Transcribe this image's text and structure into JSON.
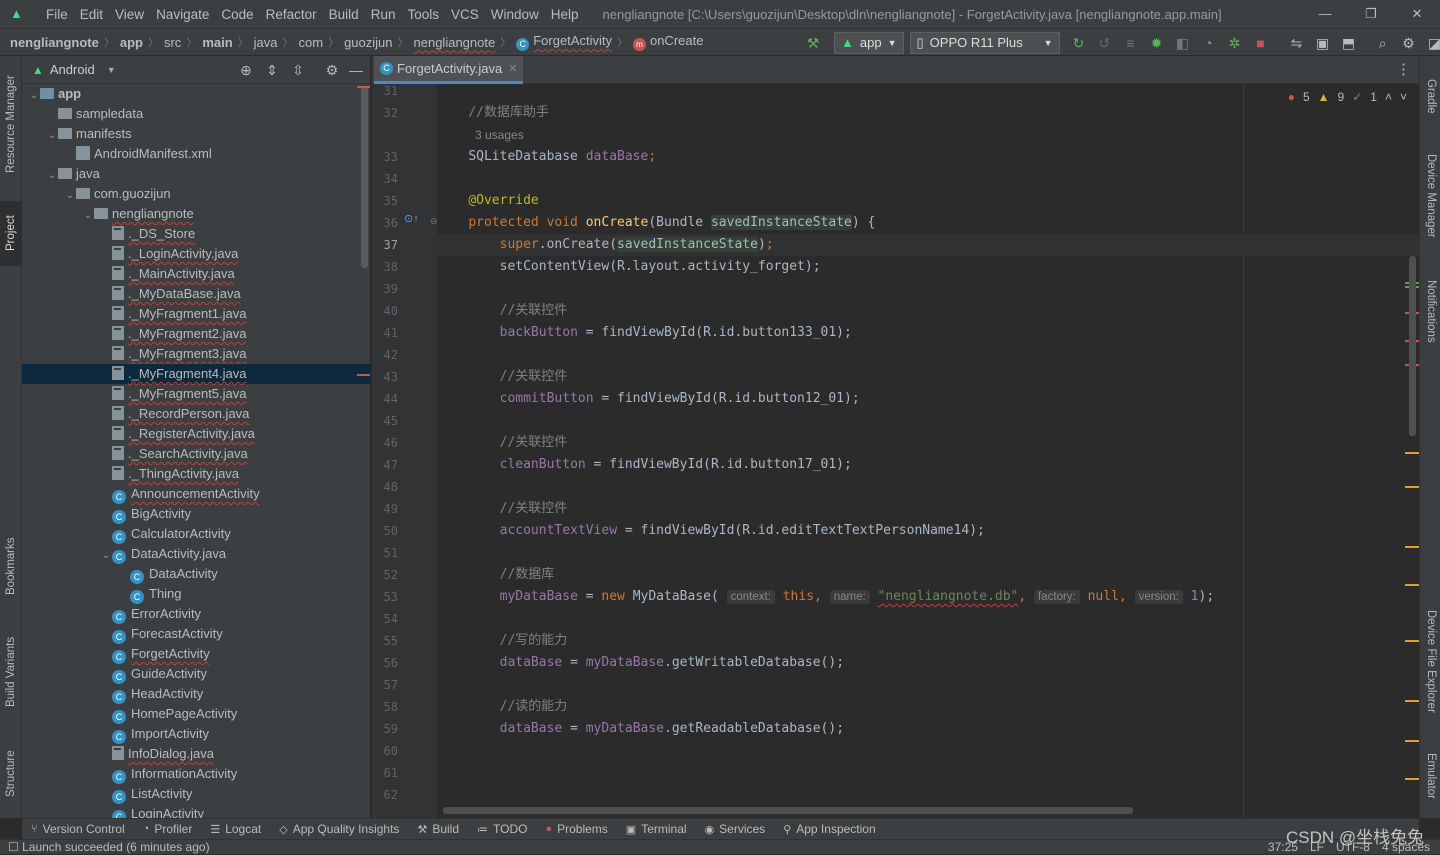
{
  "menubar": {
    "items": [
      "File",
      "Edit",
      "View",
      "Navigate",
      "Code",
      "Refactor",
      "Build",
      "Run",
      "Tools",
      "VCS",
      "Window",
      "Help"
    ],
    "window_title": "nengliangnote [C:\\Users\\guozijun\\Desktop\\dln\\nengliangnote] - ForgetActivity.java [nengliangnote.app.main]"
  },
  "breadcrumb": {
    "items": [
      "nengliangnote",
      "app",
      "src",
      "main",
      "java",
      "com",
      "guozijun",
      "nengliangnote",
      "ForgetActivity",
      "onCreate"
    ]
  },
  "run_toolbar": {
    "config": "app",
    "device": "OPPO R11 Plus"
  },
  "project_panel": {
    "view_mode": "Android",
    "tree": [
      {
        "label": "app",
        "depth": 0,
        "kind": "module",
        "expanded": true
      },
      {
        "label": "sampledata",
        "depth": 1,
        "kind": "folder"
      },
      {
        "label": "manifests",
        "depth": 1,
        "kind": "folder",
        "expanded": true
      },
      {
        "label": "AndroidManifest.xml",
        "depth": 2,
        "kind": "manifest"
      },
      {
        "label": "java",
        "depth": 1,
        "kind": "folder",
        "expanded": true
      },
      {
        "label": "com.guozijun",
        "depth": 2,
        "kind": "package",
        "expanded": true
      },
      {
        "label": "nengliangnote",
        "depth": 3,
        "kind": "package",
        "expanded": true
      },
      {
        "label": "._DS_Store",
        "depth": 4,
        "kind": "file"
      },
      {
        "label": "._LoginActivity.java",
        "depth": 4,
        "kind": "file"
      },
      {
        "label": "._MainActivity.java",
        "depth": 4,
        "kind": "file"
      },
      {
        "label": "._MyDataBase.java",
        "depth": 4,
        "kind": "file"
      },
      {
        "label": "._MyFragment1.java",
        "depth": 4,
        "kind": "file"
      },
      {
        "label": "._MyFragment2.java",
        "depth": 4,
        "kind": "file"
      },
      {
        "label": "._MyFragment3.java",
        "depth": 4,
        "kind": "file"
      },
      {
        "label": "._MyFragment4.java",
        "depth": 4,
        "kind": "file",
        "selected": true
      },
      {
        "label": "._MyFragment5.java",
        "depth": 4,
        "kind": "file"
      },
      {
        "label": "._RecordPerson.java",
        "depth": 4,
        "kind": "file"
      },
      {
        "label": "._RegisterActivity.java",
        "depth": 4,
        "kind": "file"
      },
      {
        "label": "._SearchActivity.java",
        "depth": 4,
        "kind": "file"
      },
      {
        "label": "._ThingActivity.java",
        "depth": 4,
        "kind": "file"
      },
      {
        "label": "AnnouncementActivity",
        "depth": 4,
        "kind": "class"
      },
      {
        "label": "BigActivity",
        "depth": 4,
        "kind": "class"
      },
      {
        "label": "CalculatorActivity",
        "depth": 4,
        "kind": "class"
      },
      {
        "label": "DataActivity.java",
        "depth": 4,
        "kind": "class",
        "expanded": true
      },
      {
        "label": "DataActivity",
        "depth": 5,
        "kind": "class"
      },
      {
        "label": "Thing",
        "depth": 5,
        "kind": "class"
      },
      {
        "label": "ErrorActivity",
        "depth": 4,
        "kind": "class"
      },
      {
        "label": "ForecastActivity",
        "depth": 4,
        "kind": "class"
      },
      {
        "label": "ForgetActivity",
        "depth": 4,
        "kind": "class"
      },
      {
        "label": "GuideActivity",
        "depth": 4,
        "kind": "class"
      },
      {
        "label": "HeadActivity",
        "depth": 4,
        "kind": "class"
      },
      {
        "label": "HomePageActivity",
        "depth": 4,
        "kind": "class"
      },
      {
        "label": "ImportActivity",
        "depth": 4,
        "kind": "class"
      },
      {
        "label": "InfoDialog.java",
        "depth": 4,
        "kind": "file"
      },
      {
        "label": "InformationActivity",
        "depth": 4,
        "kind": "class"
      },
      {
        "label": "ListActivity",
        "depth": 4,
        "kind": "class"
      },
      {
        "label": "LoginActivity",
        "depth": 4,
        "kind": "class"
      }
    ]
  },
  "left_tool_tabs": [
    "Resource Manager",
    "Project",
    "Bookmarks",
    "Build Variants",
    "Structure"
  ],
  "right_tool_tabs": [
    "Gradle",
    "Device Manager",
    "Notifications",
    "Device File Explorer",
    "Emulator"
  ],
  "editor": {
    "tab_label": "ForgetActivity.java",
    "inspections": {
      "errors": "5",
      "warnings": "9",
      "weak_warnings": "1"
    },
    "usages_text": "3 usages",
    "line_numbers": [
      "31",
      "32",
      "",
      "33",
      "34",
      "35",
      "36",
      "37",
      "38",
      "39",
      "40",
      "41",
      "42",
      "43",
      "44",
      "45",
      "46",
      "47",
      "48",
      "49",
      "50",
      "51",
      "52",
      "53",
      "54",
      "55",
      "56",
      "57",
      "58",
      "59",
      "60",
      "61",
      "62"
    ],
    "current_line": "37",
    "code": {
      "c1": "//数据库助手",
      "l33_type": "SQLiteDatabase",
      "l33_field": "dataBase",
      "l35": "@Override",
      "l36_kw": "protected void",
      "l36_meth": "onCreate",
      "l36_type": "Bundle",
      "l36_param": "savedInstanceState",
      "l37_super": "super",
      "l37_call": ".onCreate(",
      "l37_arg": "savedInstanceState",
      "l38": "setContentView(R.layout.activity_forget);",
      "c_link": "//关联控件",
      "l41_field": "backButton",
      "l41_rest": " = findViewById(R.id.button133_01);",
      "l44_field": "commitButton",
      "l44_rest": " = findViewById(R.id.button12_01);",
      "l47_field": "cleanButton",
      "l47_rest": " = findViewById(R.id.button17_01);",
      "l50_field": "accountTextView",
      "l50_rest": " = findViewById(R.id.editTextTextPersonName14);",
      "c_db": "//数据库",
      "l53_field": "myDataBase",
      "l53_a": " = ",
      "l53_new": "new",
      "l53_cls": " MyDataBase(",
      "hint_context": "context:",
      "l53_this": "this",
      "hint_name": "name:",
      "l53_str": "\"nengliangnote.db\"",
      "hint_factory": "factory:",
      "l53_null": "null",
      "hint_version": "version:",
      "l53_num": "1",
      "l53_end": ");",
      "c_write": "//写的能力",
      "l56_field": "dataBase",
      "l56_mid": " = ",
      "l56_field2": "myDataBase",
      "l56_rest": ".getWritableDatabase();",
      "c_read": "//读的能力",
      "l59_field": "dataBase",
      "l59_mid": " = ",
      "l59_field2": "myDataBase",
      "l59_rest": ".getReadableDatabase();"
    }
  },
  "bottom_tools": [
    "Version Control",
    "Profiler",
    "Logcat",
    "App Quality Insights",
    "Build",
    "TODO",
    "Problems",
    "Terminal",
    "Services",
    "App Inspection"
  ],
  "statusbar": {
    "message": "Launch succeeded (6 minutes ago)",
    "position": "37:25",
    "line_sep": "LF",
    "encoding": "UTF-8",
    "indent": "4 spaces"
  },
  "watermark": "CSDN @坐栈兔兔",
  "colors": {
    "accent": "#4a88c7",
    "selection": "#0d293e",
    "android_green": "#3ddc84"
  }
}
